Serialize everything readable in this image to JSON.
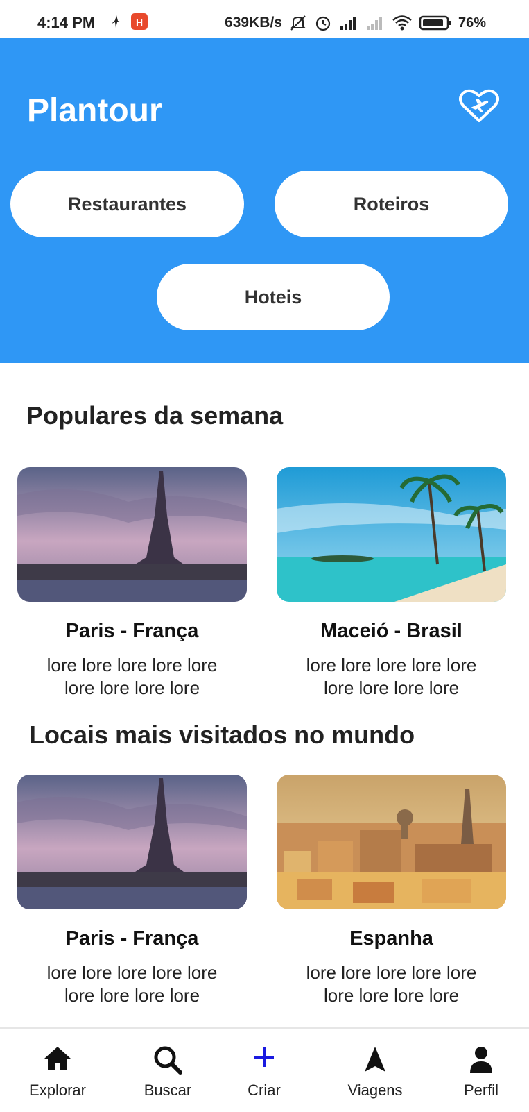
{
  "status_bar": {
    "time": "4:14 PM",
    "speed": "639KB/s",
    "battery": "76%"
  },
  "header": {
    "title": "Plantour",
    "favorite_icon": "heart-plane-icon",
    "color": "#2f97f5"
  },
  "categories": [
    {
      "label": "Restaurantes"
    },
    {
      "label": "Roteiros"
    },
    {
      "label": "Hoteis"
    }
  ],
  "popular": {
    "title": "Populares da semana",
    "cards": [
      {
        "title": "Paris - França",
        "desc": "lore lore lore lore lore lore lore lore lore",
        "image": "eiffel-tower-photo"
      },
      {
        "title": "Maceió - Brasil",
        "desc": "lore lore lore lore lore lore lore lore lore",
        "image": "beach-palm-photo"
      }
    ]
  },
  "most_visited": {
    "title": "Locais mais visitados no mundo",
    "cards": [
      {
        "title": "Paris - França",
        "desc": "lore lore lore lore lore lore lore lore lore",
        "image": "eiffel-tower-photo"
      },
      {
        "title": "Espanha",
        "desc": "lore lore lore lore lore lore lore lore lore",
        "image": "spanish-city-photo"
      }
    ]
  },
  "bottom_nav": [
    {
      "label": "Explorar",
      "icon": "home-icon"
    },
    {
      "label": "Buscar",
      "icon": "search-icon"
    },
    {
      "label": "Criar",
      "icon": "plus-icon",
      "color": "#1a1ae0"
    },
    {
      "label": "Viagens",
      "icon": "navigation-arrow-icon"
    },
    {
      "label": "Perfil",
      "icon": "person-icon"
    }
  ]
}
